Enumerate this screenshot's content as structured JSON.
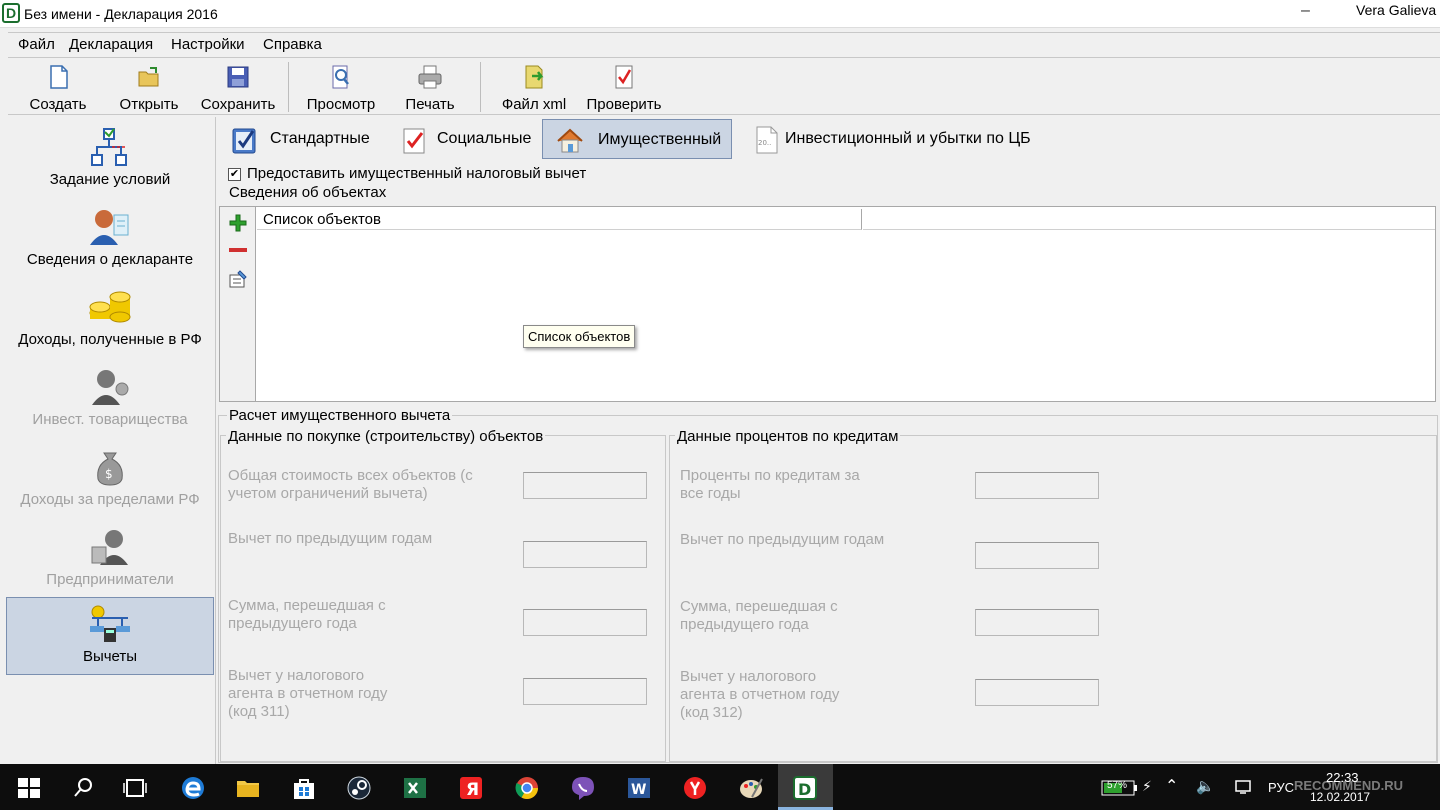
{
  "window": {
    "title": "Без имени - Декларация 2016",
    "minimize": "–",
    "user": "Vera Galieva",
    "app_icon_letter": "D"
  },
  "menu": [
    "Файл",
    "Декларация",
    "Настройки",
    "Справка"
  ],
  "toolbar": {
    "create": "Создать",
    "open": "Открыть",
    "save": "Сохранить",
    "preview": "Просмотр",
    "print": "Печать",
    "xml": "Файл xml",
    "check": "Проверить"
  },
  "sidebar": [
    {
      "label": "Задание условий",
      "icon": "conditions-icon",
      "enabled": true
    },
    {
      "label": "Сведения о декларанте",
      "icon": "declarant-icon",
      "enabled": true
    },
    {
      "label": "Доходы, полученные в РФ",
      "icon": "income-coins-icon",
      "enabled": true
    },
    {
      "label": "Инвест. товарищества",
      "icon": "investment-icon",
      "enabled": false
    },
    {
      "label": "Доходы за пределами РФ",
      "icon": "money-bag-icon",
      "enabled": false
    },
    {
      "label": "Предприниматели",
      "icon": "entrepreneur-icon",
      "enabled": false
    },
    {
      "label": "Вычеты",
      "icon": "deductions-icon",
      "enabled": true,
      "active": true
    }
  ],
  "tabs": [
    {
      "label": "Стандартные",
      "icon": "standard-check-icon"
    },
    {
      "label": "Социальные",
      "icon": "social-check-icon"
    },
    {
      "label": "Имущественный",
      "icon": "house-icon",
      "active": true
    },
    {
      "label": "Инвестиционный и убытки по ЦБ",
      "icon": "document-icon"
    }
  ],
  "property_deduction": {
    "checkbox_label": "Предоставить имущественный налоговый вычет",
    "checkbox_checked": true,
    "checkbox_mark": "✔",
    "objects_group": "Сведения об объектах",
    "objects_column": "Список объектов",
    "tooltip": "Список объектов",
    "calc_group": "Расчет имущественного вычета",
    "purchase_group": "Данные по покупке (строительству) объектов",
    "purchase_fields": [
      {
        "label": "Общая стоимость всех объектов (с учетом ограничений вычета)",
        "value": ""
      },
      {
        "label": "Вычет по предыдущим годам",
        "value": ""
      },
      {
        "label": "Сумма, перешедшая с предыдущего года",
        "value": ""
      },
      {
        "label": "Вычет у налогового агента в отчетном году (код 311)",
        "value": ""
      }
    ],
    "credit_group": "Данные процентов по кредитам",
    "credit_fields": [
      {
        "label": "Проценты по кредитам за все годы",
        "value": ""
      },
      {
        "label": "Вычет по предыдущим годам",
        "value": ""
      },
      {
        "label": "Сумма, перешедшая с предыдущего года",
        "value": ""
      },
      {
        "label": "Вычет у налогового агента в отчетном году (код 312)",
        "value": ""
      }
    ]
  },
  "taskbar": {
    "battery": "57%",
    "language": "РУС",
    "time": "22:33",
    "date": "12.02.2017",
    "watermark": "RECOMMEND.RU"
  }
}
